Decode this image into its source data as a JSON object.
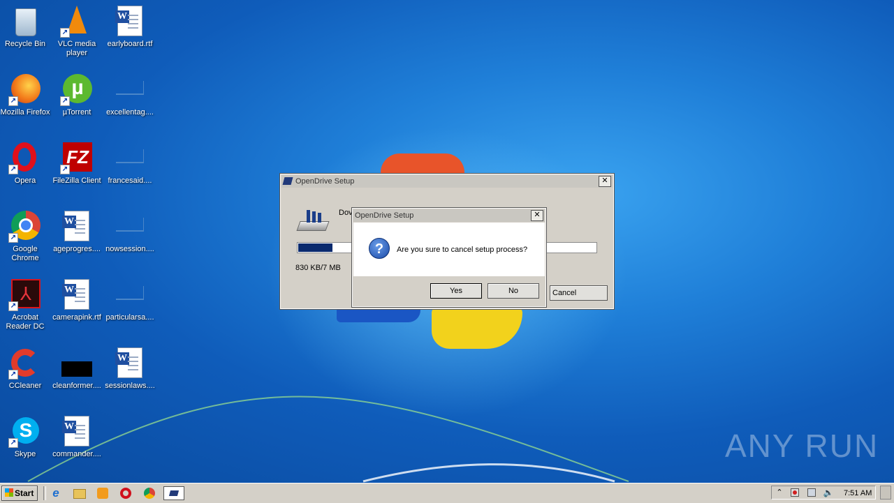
{
  "desktop": {
    "icons": [
      {
        "label": "Recycle Bin",
        "icon": "recycle-bin-icon"
      },
      {
        "label": "VLC media player",
        "icon": "vlc-icon"
      },
      {
        "label": "earlyboard.rtf",
        "icon": "word-document-icon"
      },
      {
        "label": "Mozilla Firefox",
        "icon": "firefox-icon"
      },
      {
        "label": "µTorrent",
        "icon": "utorrent-icon"
      },
      {
        "label": "excellentag....",
        "icon": "blank-file-icon"
      },
      {
        "label": "Opera",
        "icon": "opera-icon"
      },
      {
        "label": "FileZilla Client",
        "icon": "filezilla-icon"
      },
      {
        "label": "francesaid....",
        "icon": "blank-file-icon"
      },
      {
        "label": "Google Chrome",
        "icon": "chrome-icon"
      },
      {
        "label": "ageprogres....",
        "icon": "word-document-icon"
      },
      {
        "label": "nowsession....",
        "icon": "blank-file-icon"
      },
      {
        "label": "Acrobat Reader DC",
        "icon": "acrobat-icon"
      },
      {
        "label": "camerapink.rtf",
        "icon": "word-document-icon"
      },
      {
        "label": "particularsa....",
        "icon": "blank-file-icon"
      },
      {
        "label": "CCleaner",
        "icon": "ccleaner-icon"
      },
      {
        "label": "cleanformer....",
        "icon": "black-thumbnail-icon"
      },
      {
        "label": "sessionlaws....",
        "icon": "word-document-icon"
      },
      {
        "label": "Skype",
        "icon": "skype-icon"
      },
      {
        "label": "commander....",
        "icon": "word-document-icon"
      }
    ],
    "watermark": "ANY RUN"
  },
  "setup_dialog": {
    "title": "OpenDrive Setup",
    "status_text": "Dov",
    "progress": 0.12,
    "size_text": "830 KB/7 MB",
    "cancel_label": "Cancel",
    "close_label": "✕"
  },
  "confirm_dialog": {
    "title": "OpenDrive Setup",
    "message": "Are you sure to cancel setup process?",
    "yes_label": "Yes",
    "no_label": "No",
    "close_label": "✕"
  },
  "taskbar": {
    "start_label": "Start",
    "clock": "7:51 AM"
  },
  "colors": {
    "accent": "#0c3b8c",
    "progress_fill": "#0a2a6e"
  }
}
